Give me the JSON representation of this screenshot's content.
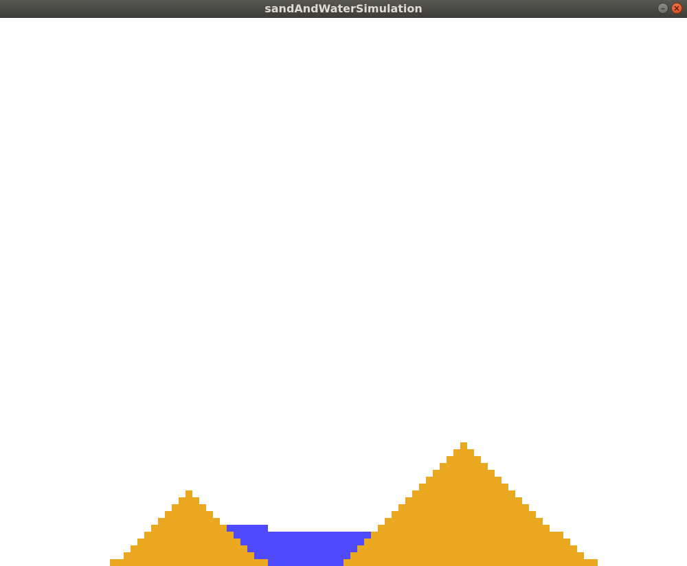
{
  "window": {
    "title": "sandAndWaterSimulation",
    "minimize_icon": "minimize-icon",
    "close_icon": "close-icon"
  },
  "simulation": {
    "colors": {
      "sand": "#eaa821",
      "water": "#4f4afe",
      "background": "#ffffff"
    },
    "grid_cols": 100,
    "grid_rows": 80,
    "sand_columns": [
      [
        16,
        16,
        79
      ],
      [
        17,
        17,
        79
      ],
      [
        18,
        18,
        78
      ],
      [
        19,
        19,
        77
      ],
      [
        20,
        20,
        76
      ],
      [
        21,
        21,
        75
      ],
      [
        22,
        22,
        74
      ],
      [
        23,
        23,
        73
      ],
      [
        24,
        24,
        72
      ],
      [
        25,
        25,
        71
      ],
      [
        26,
        26,
        70
      ],
      [
        27,
        27,
        69
      ],
      [
        28,
        28,
        70
      ],
      [
        29,
        29,
        71
      ],
      [
        30,
        30,
        72
      ],
      [
        31,
        31,
        73
      ],
      [
        32,
        32,
        74
      ],
      [
        33,
        33,
        75
      ],
      [
        34,
        34,
        76
      ],
      [
        35,
        35,
        77
      ],
      [
        36,
        36,
        78
      ],
      [
        37,
        37,
        79
      ],
      [
        38,
        38,
        79
      ],
      [
        50,
        50,
        79
      ],
      [
        51,
        51,
        78
      ],
      [
        52,
        52,
        77
      ],
      [
        53,
        53,
        76
      ],
      [
        54,
        54,
        75
      ],
      [
        55,
        55,
        74
      ],
      [
        56,
        56,
        73
      ],
      [
        57,
        57,
        72
      ],
      [
        58,
        58,
        71
      ],
      [
        59,
        59,
        70
      ],
      [
        60,
        60,
        69
      ],
      [
        61,
        61,
        68
      ],
      [
        62,
        62,
        67
      ],
      [
        63,
        63,
        66
      ],
      [
        64,
        64,
        65
      ],
      [
        65,
        65,
        64
      ],
      [
        66,
        66,
        63
      ],
      [
        67,
        67,
        62
      ],
      [
        68,
        68,
        63
      ],
      [
        69,
        69,
        64
      ],
      [
        70,
        70,
        65
      ],
      [
        71,
        71,
        66
      ],
      [
        72,
        72,
        67
      ],
      [
        73,
        73,
        68
      ],
      [
        74,
        74,
        69
      ],
      [
        75,
        75,
        70
      ],
      [
        76,
        76,
        71
      ],
      [
        77,
        77,
        72
      ],
      [
        78,
        78,
        73
      ],
      [
        79,
        79,
        74
      ],
      [
        80,
        80,
        75
      ],
      [
        81,
        81,
        75
      ],
      [
        82,
        82,
        76
      ],
      [
        83,
        83,
        77
      ],
      [
        84,
        84,
        78
      ],
      [
        85,
        85,
        79
      ],
      [
        86,
        86,
        79
      ]
    ],
    "water_cells": [
      [
        33,
        74
      ],
      [
        34,
        74
      ],
      [
        35,
        74
      ],
      [
        36,
        74
      ],
      [
        37,
        74
      ],
      [
        38,
        74
      ],
      [
        34,
        75
      ],
      [
        35,
        75
      ],
      [
        36,
        75
      ],
      [
        37,
        75
      ],
      [
        38,
        75
      ],
      [
        35,
        76
      ],
      [
        36,
        76
      ],
      [
        37,
        76
      ],
      [
        38,
        76
      ],
      [
        36,
        77
      ],
      [
        37,
        77
      ],
      [
        38,
        77
      ],
      [
        37,
        78
      ],
      [
        38,
        78
      ]
    ],
    "water_spans": [
      [
        39,
        49,
        75
      ],
      [
        50,
        53,
        75
      ],
      [
        39,
        51,
        76
      ],
      [
        52,
        52,
        76
      ],
      [
        39,
        51,
        77
      ],
      [
        39,
        50,
        78
      ],
      [
        39,
        49,
        79
      ]
    ]
  }
}
